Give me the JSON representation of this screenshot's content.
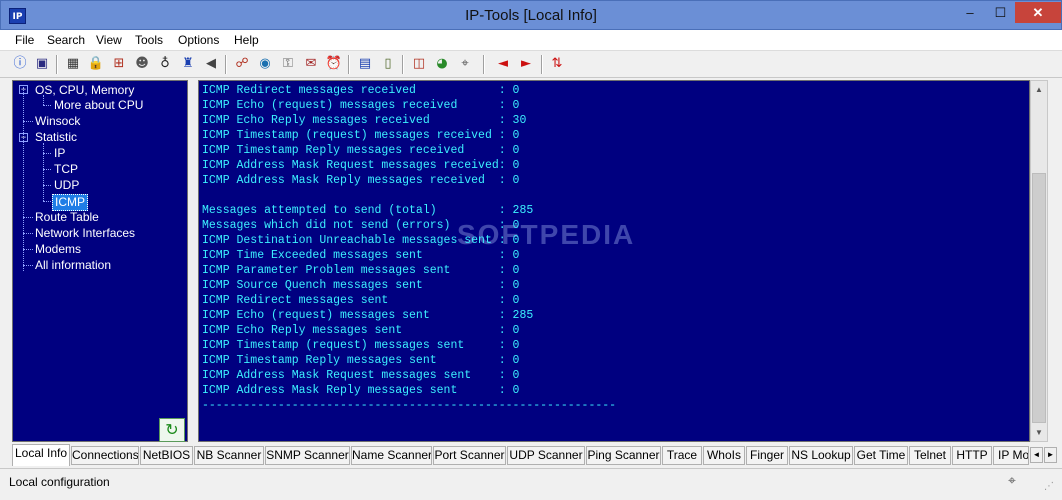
{
  "window": {
    "title": "IP-Tools [Local Info]",
    "icon_label": "IP",
    "minimize": "–",
    "maximize": "☐",
    "close": "✕"
  },
  "menu": [
    "File",
    "Search",
    "View",
    "Tools",
    "Options",
    "Help"
  ],
  "toolbar": {
    "icons": [
      {
        "name": "info-icon",
        "glyph": "ⓘ",
        "color": "#1a4fd0"
      },
      {
        "name": "monitor-icon",
        "glyph": "▣",
        "color": "#2a2a80"
      },
      {
        "name": "grid-icon",
        "glyph": "▦",
        "color": "#333"
      },
      {
        "name": "lock-icon",
        "glyph": "🔒",
        "color": "#8a6b00"
      },
      {
        "name": "network-tree-icon",
        "glyph": "⊞",
        "color": "#b03020"
      },
      {
        "name": "users-icon",
        "glyph": "☻",
        "color": "#555"
      },
      {
        "name": "binoculars-icon",
        "glyph": "♁",
        "color": "#222"
      },
      {
        "name": "tower-icon",
        "glyph": "♜",
        "color": "#1a3fb0"
      },
      {
        "name": "speaker-icon",
        "glyph": "◀",
        "color": "#444"
      },
      {
        "name": "share-icon",
        "glyph": "☍",
        "color": "#b03020"
      },
      {
        "name": "globe-icon",
        "glyph": "◉",
        "color": "#1a70b0"
      },
      {
        "name": "key-icon",
        "glyph": "⚿",
        "color": "#666"
      },
      {
        "name": "mail-icon",
        "glyph": "✉",
        "color": "#a02020"
      },
      {
        "name": "clock-icon",
        "glyph": "⏰",
        "color": "#b02020"
      },
      {
        "name": "computer-icon",
        "glyph": "▤",
        "color": "#1a3fb0"
      },
      {
        "name": "document-icon",
        "glyph": "▯",
        "color": "#556b2f"
      },
      {
        "name": "chart-icon",
        "glyph": "◫",
        "color": "#b03020"
      },
      {
        "name": "pie-icon",
        "glyph": "◕",
        "color": "#2a8a2a"
      },
      {
        "name": "satellite-icon",
        "glyph": "⌖",
        "color": "#555"
      },
      {
        "name": "arrow-left-icon",
        "glyph": "◄",
        "color": "#cc1010"
      },
      {
        "name": "arrow-right-icon",
        "glyph": "►",
        "color": "#cc1010"
      },
      {
        "name": "swap-icon",
        "glyph": "⇅",
        "color": "#cc1010"
      }
    ]
  },
  "tree": {
    "items": [
      {
        "label": "OS, CPU, Memory"
      },
      {
        "label": "More about CPU"
      },
      {
        "label": "Winsock"
      },
      {
        "label": "Statistic"
      },
      {
        "label": "IP"
      },
      {
        "label": "TCP"
      },
      {
        "label": "UDP"
      },
      {
        "label": "ICMP"
      },
      {
        "label": "Route Table"
      },
      {
        "label": "Network Interfaces"
      },
      {
        "label": "Modems"
      },
      {
        "label": "All information"
      }
    ],
    "expander": "−",
    "refresh_glyph": "↻"
  },
  "output": {
    "watermark": "SOFTPEDIA",
    "lines": [
      "ICMP Redirect messages received            : 0",
      "ICMP Echo (request) messages received      : 0",
      "ICMP Echo Reply messages received          : 30",
      "ICMP Timestamp (request) messages received : 0",
      "ICMP Timestamp Reply messages received     : 0",
      "ICMP Address Mask Request messages received: 0",
      "ICMP Address Mask Reply messages received  : 0",
      "",
      "Messages attempted to send (total)         : 285",
      "Messages which did not send (errors)       : 0",
      "ICMP Destination Unreachable messages sent : 0",
      "ICMP Time Exceeded messages sent           : 0",
      "ICMP Parameter Problem messages sent       : 0",
      "ICMP Source Quench messages sent           : 0",
      "ICMP Redirect messages sent                : 0",
      "ICMP Echo (request) messages sent          : 285",
      "ICMP Echo Reply messages sent              : 0",
      "ICMP Timestamp (request) messages sent     : 0",
      "ICMP Timestamp Reply messages sent         : 0",
      "ICMP Address Mask Request messages sent    : 0",
      "ICMP Address Mask Reply messages sent      : 0",
      "------------------------------------------------------------"
    ]
  },
  "scrollbar": {
    "up": "▲",
    "down": "▼"
  },
  "tabs": [
    "Local Info",
    "Connections",
    "NetBIOS",
    "NB Scanner",
    "SNMP Scanner",
    "Name Scanner",
    "Port Scanner",
    "UDP Scanner",
    "Ping Scanner",
    "Trace",
    "WhoIs",
    "Finger",
    "NS Lookup",
    "Get Time",
    "Telnet",
    "HTTP",
    "IP Monitor"
  ],
  "tab_arrows": {
    "left": "◄",
    "right": "►"
  },
  "status": {
    "text": "Local configuration",
    "icon": "⌖",
    "grip": "⋰"
  }
}
